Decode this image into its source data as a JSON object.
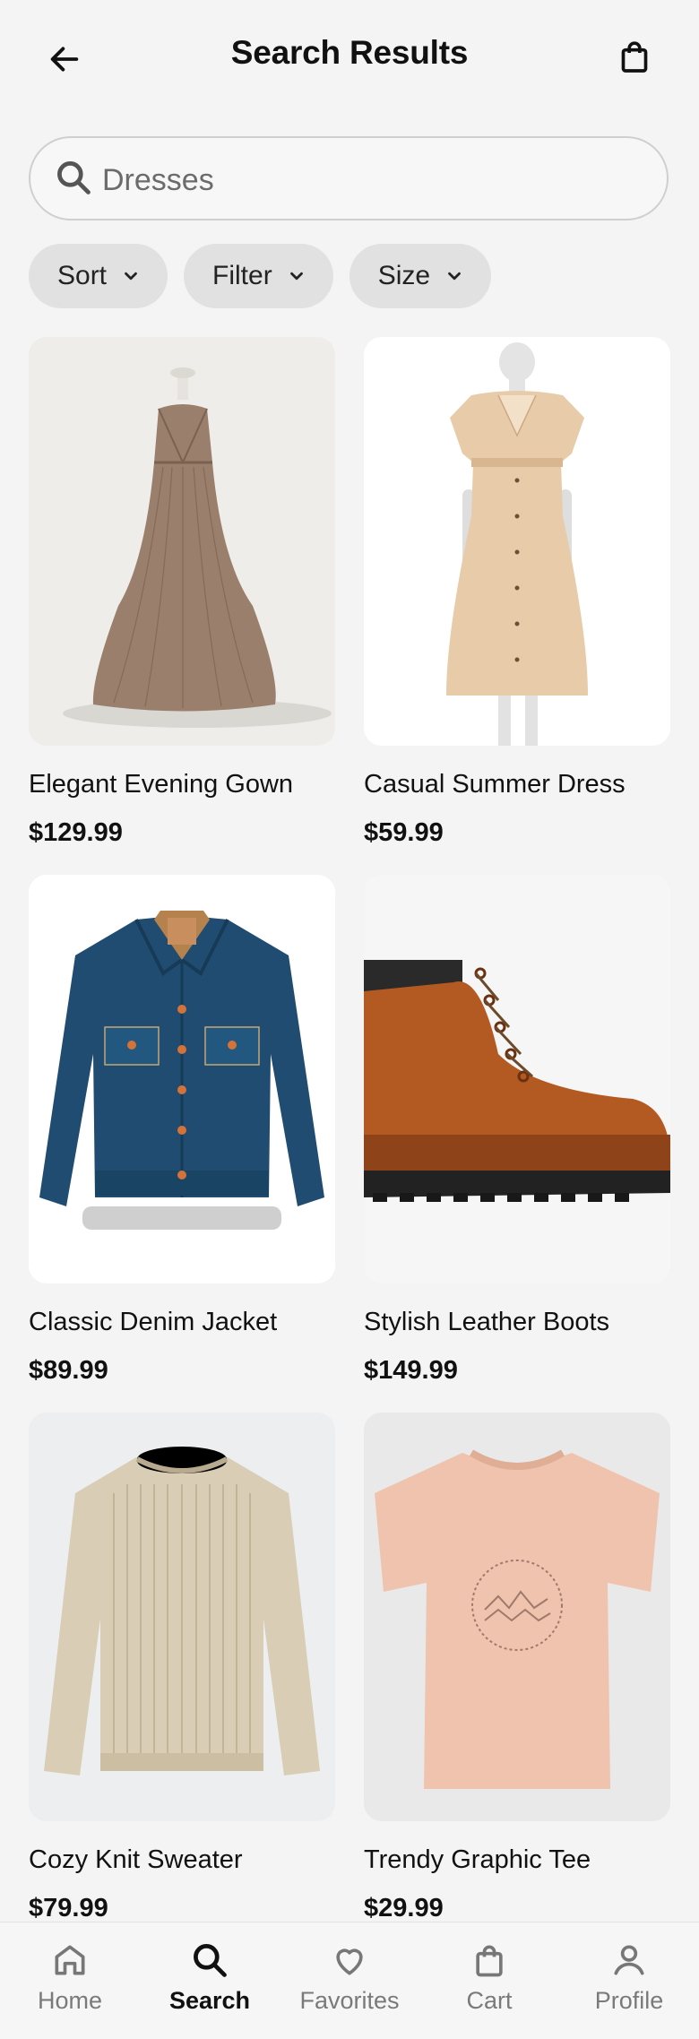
{
  "header": {
    "title": "Search Results",
    "back_icon": "arrow-left-icon",
    "cart_icon": "shopping-bag-icon"
  },
  "search": {
    "value": "Dresses",
    "placeholder": "Dresses",
    "icon": "search-icon"
  },
  "filters": [
    {
      "label": "Sort",
      "icon": "chevron-down-icon"
    },
    {
      "label": "Filter",
      "icon": "chevron-down-icon"
    },
    {
      "label": "Size",
      "icon": "chevron-down-icon"
    }
  ],
  "products": [
    {
      "name": "Elegant Evening Gown",
      "price": "$129.99",
      "image": "evening-gown-image",
      "color": "#9a7f6c"
    },
    {
      "name": "Casual Summer Dress",
      "price": "$59.99",
      "image": "summer-dress-image",
      "color": "#e8cba8"
    },
    {
      "name": "Classic Denim Jacket",
      "price": "$89.99",
      "image": "denim-jacket-image",
      "color": "#1f4c70"
    },
    {
      "name": "Stylish Leather Boots",
      "price": "$149.99",
      "image": "leather-boots-image",
      "color": "#b35a22"
    },
    {
      "name": "Cozy Knit Sweater",
      "price": "$79.99",
      "image": "knit-sweater-image",
      "color": "#d9cdb5"
    },
    {
      "name": "Trendy Graphic Tee",
      "price": "$29.99",
      "image": "graphic-tee-image",
      "color": "#efc3ad"
    }
  ],
  "nav": {
    "active": "Search",
    "items": [
      {
        "label": "Home",
        "icon": "home-icon"
      },
      {
        "label": "Search",
        "icon": "search-icon"
      },
      {
        "label": "Favorites",
        "icon": "heart-icon"
      },
      {
        "label": "Cart",
        "icon": "shopping-bag-icon"
      },
      {
        "label": "Profile",
        "icon": "user-icon"
      }
    ]
  }
}
